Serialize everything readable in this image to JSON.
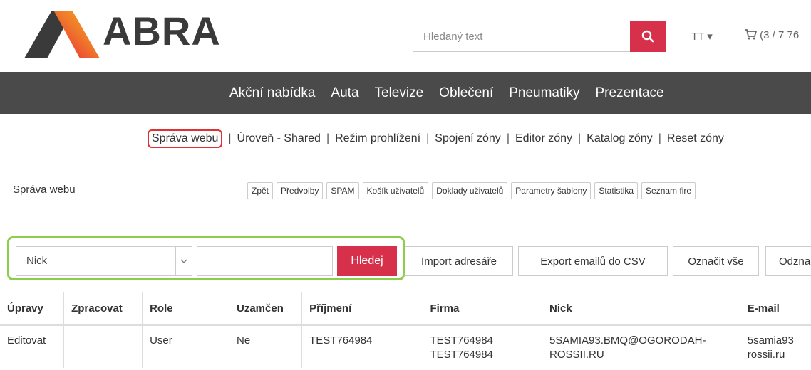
{
  "header": {
    "logo_text": "ABRA",
    "search_placeholder": "Hledaný text",
    "user_menu": "TT ▾",
    "cart_text": "(3 / 7 76"
  },
  "nav": {
    "items": [
      "Akční nabídka",
      "Auta",
      "Televize",
      "Oblečení",
      "Pneumatiky",
      "Prezentace"
    ]
  },
  "admin_links": {
    "items": [
      "Správa webu",
      "Úroveň - Shared",
      "Režim prohlížení",
      "Spojení zóny",
      "Editor zóny",
      "Katalog zóny",
      "Reset zóny"
    ],
    "separator": "|"
  },
  "section": {
    "title": "Správa webu",
    "tools": [
      "Zpět",
      "Předvolby",
      "SPAM",
      "Košík uživatelů",
      "Doklady uživatelů",
      "Parametry šablony",
      "Statistika",
      "Seznam fire"
    ]
  },
  "filter": {
    "select_value": "Nick",
    "search_button": "Hledej",
    "actions": [
      "Import adresáře",
      "Export emailů do CSV",
      "Označit vše",
      "Odzna"
    ]
  },
  "table": {
    "columns": [
      "Úpravy",
      "Zpracovat",
      "Role",
      "Uzamčen",
      "Příjmení",
      "Firma",
      "Nick",
      "E-mail"
    ],
    "rows": [
      {
        "upravy": "Editovat",
        "zpracovat": "",
        "role": "User",
        "uzamcen": "Ne",
        "prijmeni": "TEST764984",
        "firma_1": "TEST764984",
        "firma_2": "TEST764984",
        "nick_1": "5SAMIA93.BMQ@OGORODAH-",
        "nick_2": "ROSSII.RU",
        "email_1": "5samia93",
        "email_2": "rossii.ru"
      }
    ]
  },
  "colors": {
    "accent_red": "#d6304a",
    "nav_bg": "#4a4a4a",
    "highlight_green": "#8ccd4e",
    "highlight_red": "#e03030"
  }
}
